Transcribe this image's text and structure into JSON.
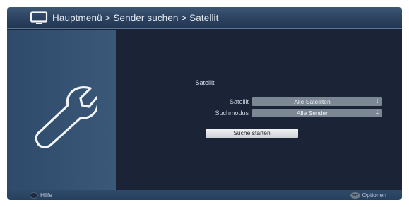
{
  "header": {
    "breadcrumb": "Hauptmenü > Sender suchen > Satellit",
    "icon": "tv-icon"
  },
  "left_panel": {
    "icon": "wrench-icon"
  },
  "form": {
    "section_title": "Satellit",
    "satellit": {
      "label": "Satellit",
      "value": "Alle Satelliten"
    },
    "suchmodus": {
      "label": "Suchmodus",
      "value": "Alle Sender"
    },
    "start_button": "Suche starten",
    "dropdown_arrow": "⇣"
  },
  "footer": {
    "help_label": "Hilfe",
    "options_key": "OPT",
    "options_label": "Optionen"
  },
  "colors": {
    "title_bar": "#2b4260",
    "left_panel": "#33506f",
    "content_bg": "#1b2437",
    "select_bg": "#7c8794",
    "button_bg": "#e2e4e7"
  }
}
